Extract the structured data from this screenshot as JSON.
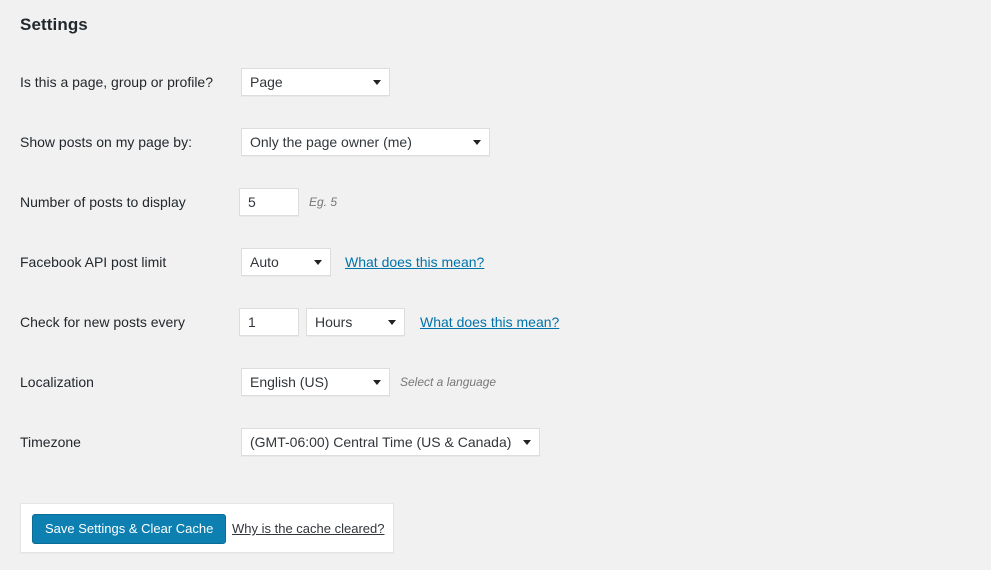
{
  "page": {
    "title": "Settings"
  },
  "rows": [
    {
      "label": "Is this a page, group or profile?",
      "select_value": "Page"
    },
    {
      "label": "Show posts on my page by:",
      "select_value": "Only the page owner (me)"
    },
    {
      "label": "Number of posts to display",
      "input_value": "5",
      "hint": "Eg. 5"
    },
    {
      "label": "Facebook API post limit",
      "select_value": "Auto",
      "link": "What does this mean?"
    },
    {
      "label": "Check for new posts every",
      "input_value": "1",
      "select_value": "Hours",
      "link": "What does this mean?"
    },
    {
      "label": "Localization",
      "select_value": "English (US)",
      "hint": "Select a language"
    },
    {
      "label": "Timezone",
      "select_value": "(GMT-06:00) Central Time (US & Canada)"
    }
  ],
  "footer": {
    "save_label": "Save Settings & Clear Cache",
    "cache_link": "Why is the cache cleared?"
  },
  "colors": {
    "background": "#f1f1f1",
    "accent": "#0d7fb0",
    "link": "#0073aa",
    "text": "#23282d"
  }
}
